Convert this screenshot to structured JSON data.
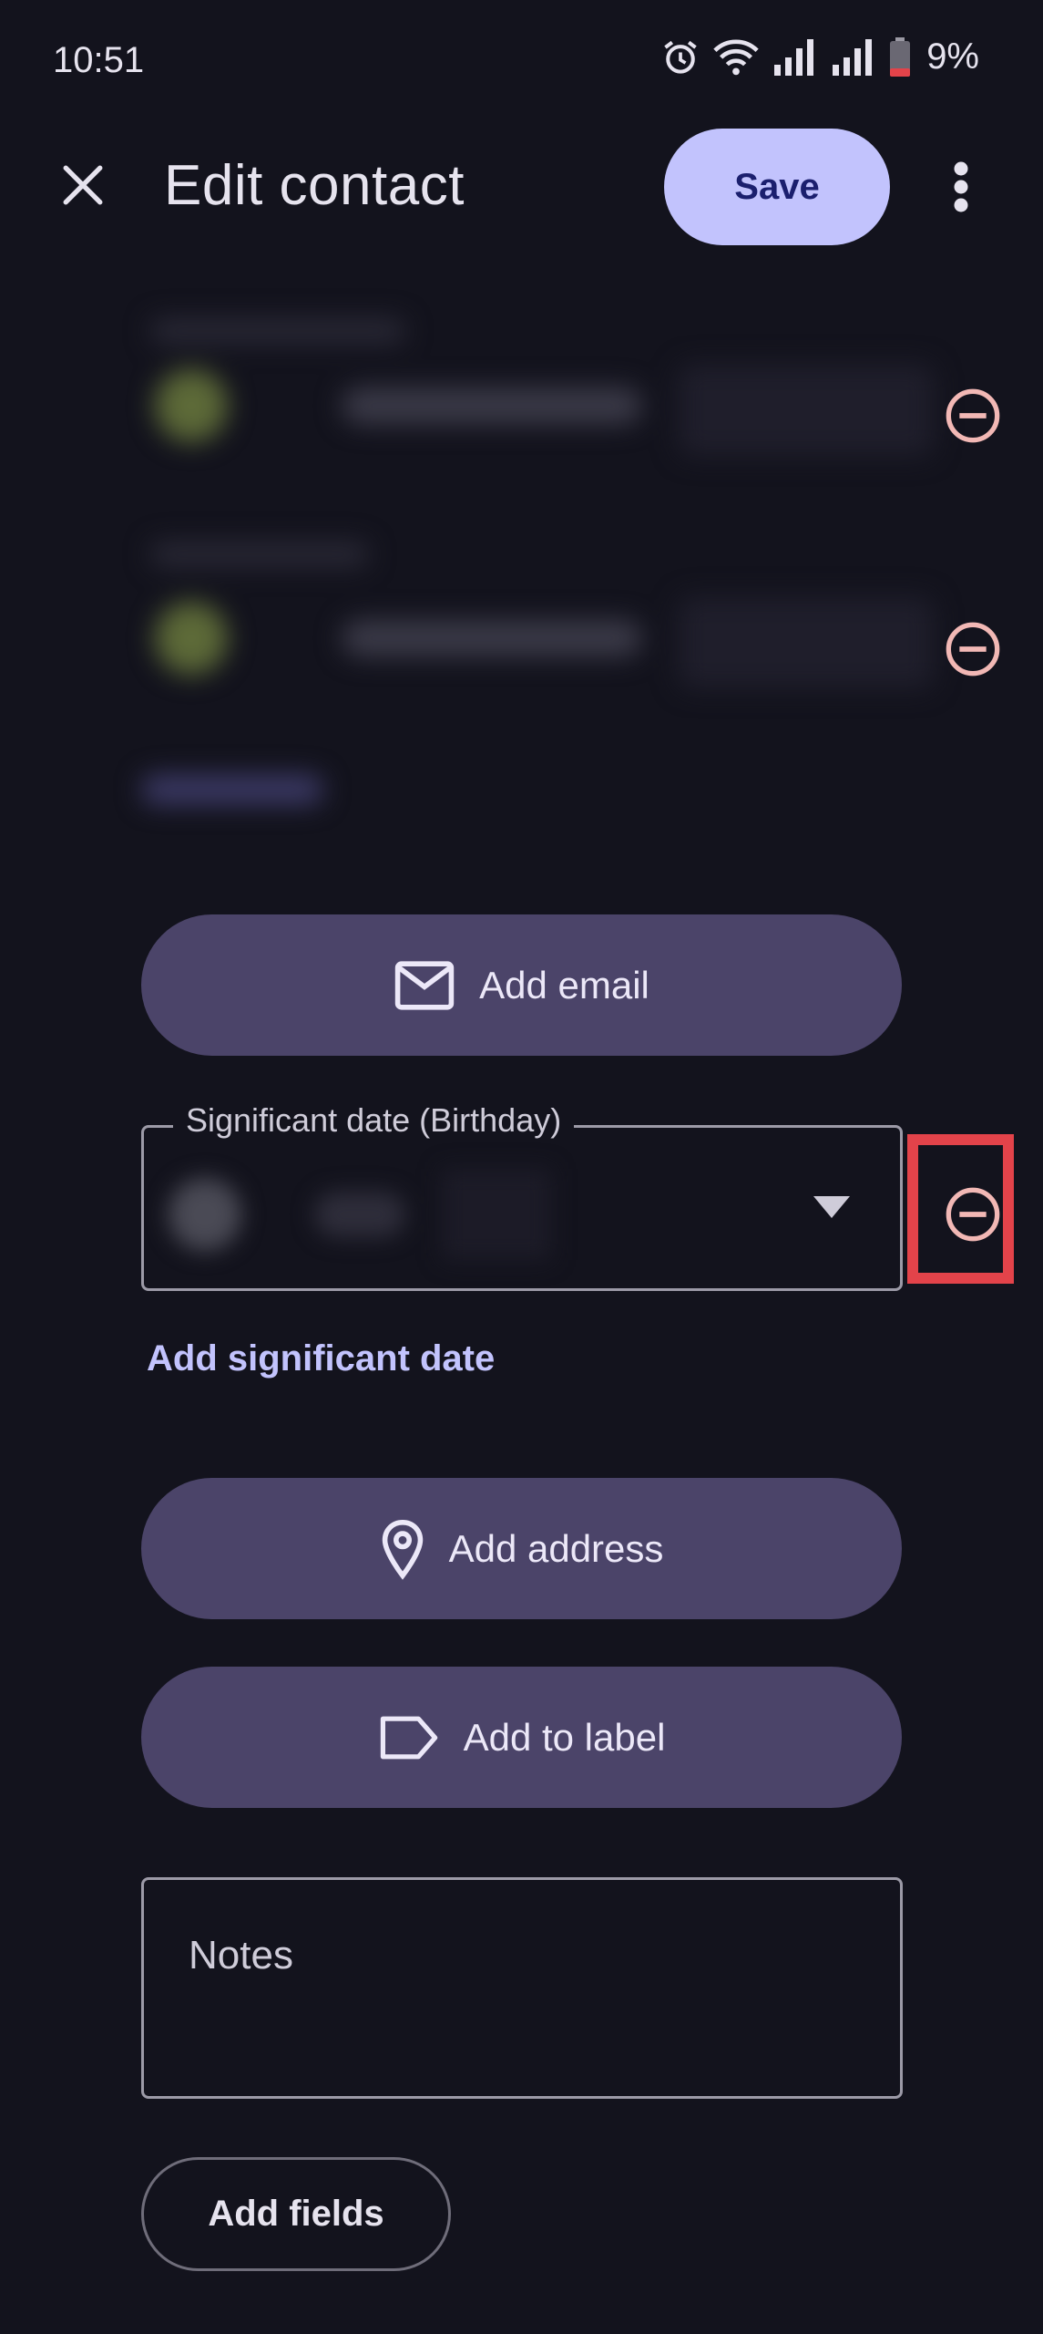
{
  "status_bar": {
    "time": "10:51",
    "battery_percent": "9%",
    "icons": [
      "alarm-icon",
      "wifi-icon",
      "signal-icon",
      "signal-icon",
      "battery-icon"
    ]
  },
  "app_bar": {
    "title": "Edit contact",
    "save_label": "Save",
    "close_icon": "close-icon",
    "more_icon": "more-vert-icon"
  },
  "buttons": {
    "add_email": "Add email",
    "add_address": "Add address",
    "add_to_label": "Add to label",
    "add_fields": "Add fields"
  },
  "significant_date": {
    "label": "Significant date (Birthday)",
    "add_link": "Add significant date"
  },
  "notes": {
    "label": "Notes"
  },
  "colors": {
    "background": "#13131d",
    "primary_container": "#c2c3fd",
    "tonal_button": "#4b4469",
    "remove_icon": "#f2b8b5",
    "highlight": "#e3434a"
  }
}
